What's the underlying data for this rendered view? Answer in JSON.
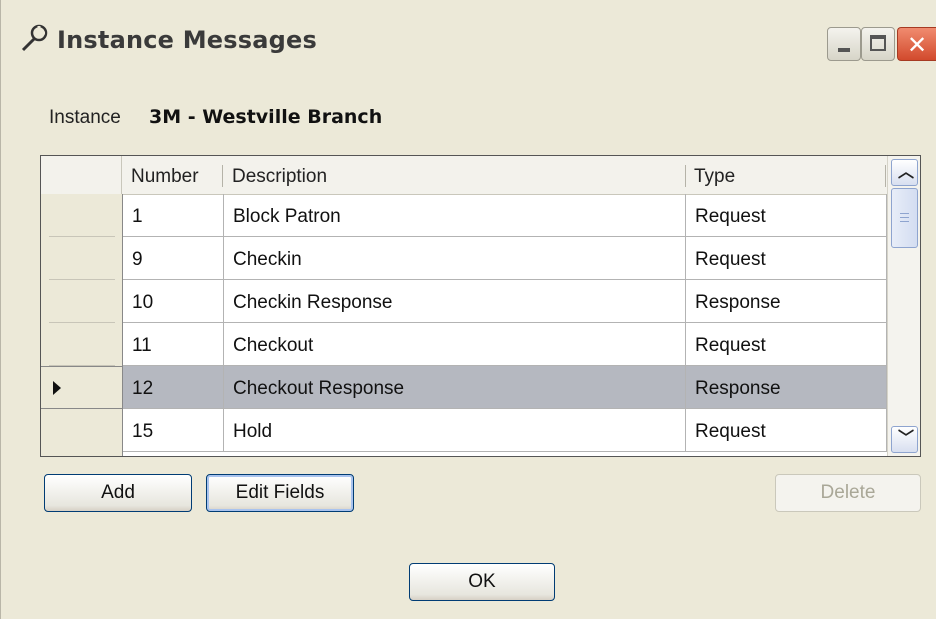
{
  "window": {
    "title": "Instance Messages"
  },
  "instance": {
    "label": "Instance",
    "value": "3M - Westville Branch"
  },
  "grid": {
    "columns": [
      "Number",
      "Description",
      "Type"
    ],
    "rows": [
      {
        "number": "1",
        "description": "Block Patron",
        "type": "Request"
      },
      {
        "number": "9",
        "description": "Checkin",
        "type": "Request"
      },
      {
        "number": "10",
        "description": "Checkin Response",
        "type": "Response"
      },
      {
        "number": "11",
        "description": "Checkout",
        "type": "Request"
      },
      {
        "number": "12",
        "description": "Checkout Response",
        "type": "Response",
        "selected": true
      },
      {
        "number": "15",
        "description": "Hold",
        "type": "Request"
      }
    ]
  },
  "buttons": {
    "add": "Add",
    "edit_fields": "Edit Fields",
    "delete": "Delete",
    "ok": "OK"
  },
  "icons": [
    "tools-icon",
    "minimize-icon",
    "maximize-icon",
    "close-icon",
    "row-pointer-icon",
    "scroll-up-icon",
    "scroll-down-icon"
  ]
}
